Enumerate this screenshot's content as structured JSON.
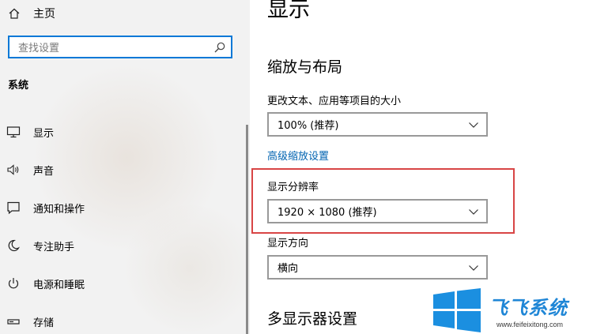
{
  "sidebar": {
    "home_label": "主页",
    "search_placeholder": "查找设置",
    "section_title": "系统",
    "items": [
      {
        "label": "显示",
        "icon": "monitor-icon"
      },
      {
        "label": "声音",
        "icon": "speaker-icon"
      },
      {
        "label": "通知和操作",
        "icon": "notification-icon"
      },
      {
        "label": "专注助手",
        "icon": "moon-icon"
      },
      {
        "label": "电源和睡眠",
        "icon": "power-icon"
      },
      {
        "label": "存储",
        "icon": "storage-icon"
      }
    ]
  },
  "main": {
    "title": "显示",
    "scale_section": {
      "heading": "缩放与布局",
      "size_label": "更改文本、应用等项目的大小",
      "size_value": "100% (推荐)",
      "advanced_link": "高级缩放设置",
      "resolution_label": "显示分辨率",
      "resolution_value": "1920 × 1080 (推荐)",
      "orientation_label": "显示方向",
      "orientation_value": "横向"
    },
    "multi_display_heading": "多显示器设置"
  },
  "watermark": {
    "brand": "飞飞系统",
    "url": "www.feifeixitong.com"
  },
  "colors": {
    "accent": "#0078d7",
    "link": "#0063b1",
    "highlight": "#d84545",
    "sidebar_bg": "#f2f2f2"
  }
}
